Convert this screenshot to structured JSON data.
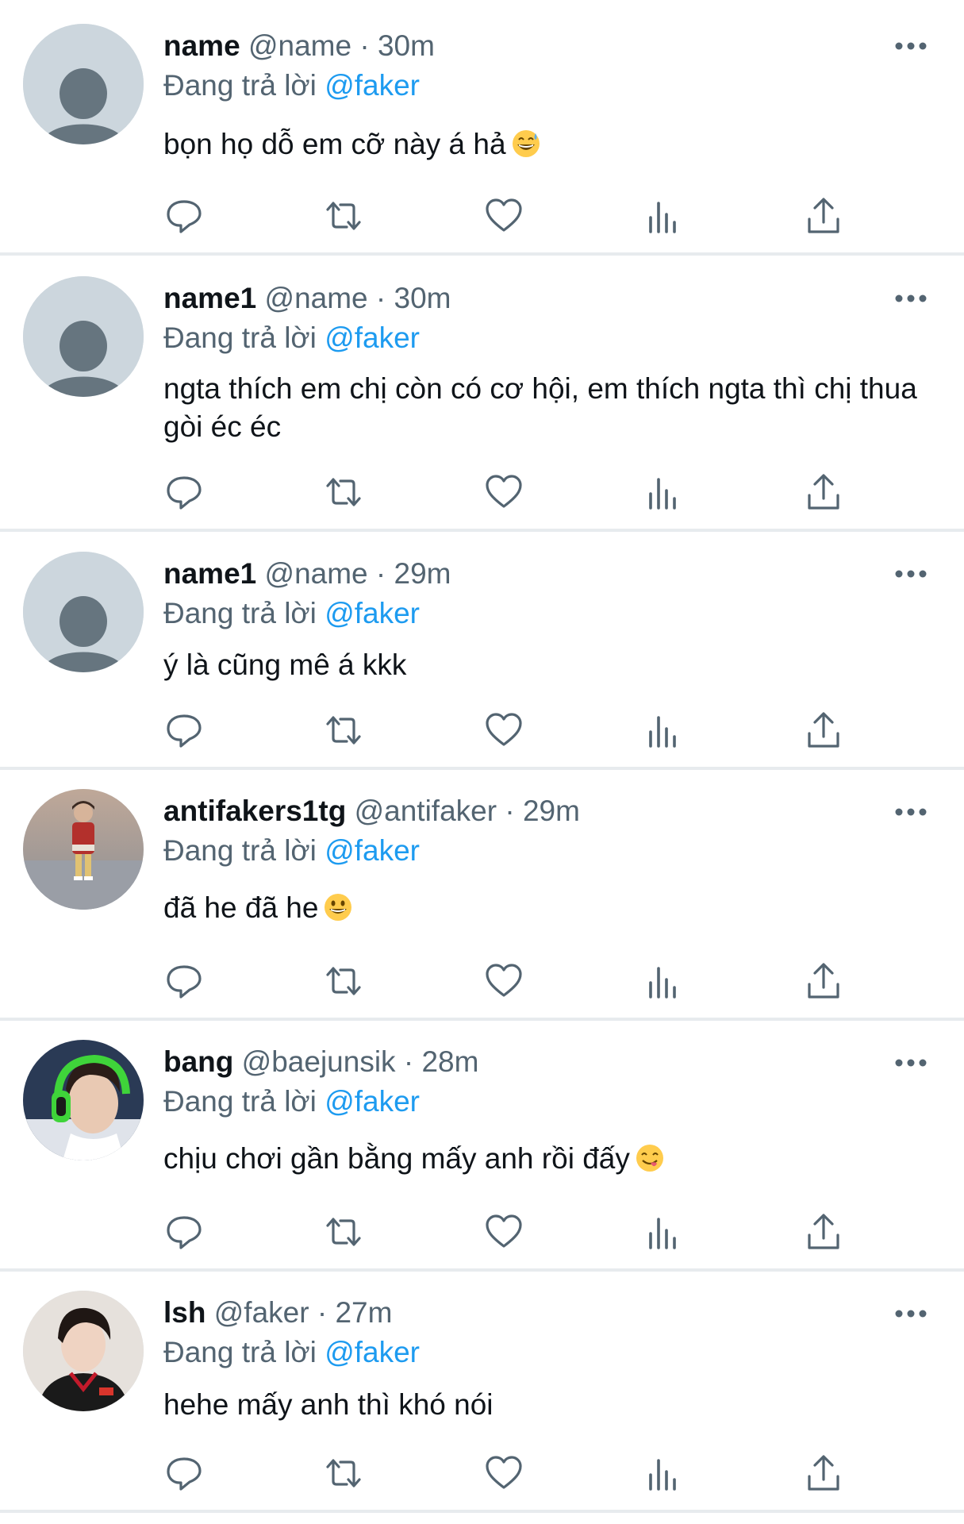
{
  "colors": {
    "mention": "#1d9bf0",
    "secondary": "#536471",
    "text": "#0f1419",
    "divider": "#e7ebee"
  },
  "tweets": [
    {
      "name": "name",
      "handle": "@name",
      "dot": "·",
      "time": "30m",
      "reply_prefix": "Đang trả lời",
      "reply_to": "@faker",
      "text": "bọn họ dỗ em cỡ này á hả",
      "emoji": "sweat-smile-emoji",
      "avatar": "default-avatar"
    },
    {
      "name": "name1",
      "handle": "@name",
      "dot": "·",
      "time": "30m",
      "reply_prefix": "Đang trả lời",
      "reply_to": "@faker",
      "text": "ngta thích em chị còn có cơ hội, em thích ngta thì chị thua gòi éc éc",
      "emoji": "",
      "avatar": "default-avatar"
    },
    {
      "name": "name1",
      "handle": "@name",
      "dot": "·",
      "time": "29m",
      "reply_prefix": "Đang trả lời",
      "reply_to": "@faker",
      "text": "ý là cũng mê á kkk",
      "emoji": "",
      "avatar": "default-avatar"
    },
    {
      "name": "antifakers1tg",
      "handle": "@antifaker",
      "dot": "·",
      "time": "29m",
      "reply_prefix": "Đang trả lời",
      "reply_to": "@faker",
      "text": "đã he đã he",
      "emoji": "grin-emoji",
      "avatar": "child-photo-avatar"
    },
    {
      "name": "bang",
      "handle": "@baejunsik",
      "dot": "·",
      "time": "28m",
      "reply_prefix": "Đang trả lời",
      "reply_to": "@faker",
      "text": "chịu chơi gần bằng mấy anh rồi đấy",
      "emoji": "yum-emoji",
      "avatar": "headset-player-avatar"
    },
    {
      "name": "lsh",
      "handle": "@faker",
      "dot": "·",
      "time": "27m",
      "reply_prefix": "Đang trả lời",
      "reply_to": "@faker",
      "text": "hehe mấy anh thì khó nói",
      "emoji": "",
      "avatar": "player-photo-avatar"
    }
  ],
  "actions": [
    "reply-icon",
    "retweet-icon",
    "like-icon",
    "views-icon",
    "share-icon"
  ]
}
